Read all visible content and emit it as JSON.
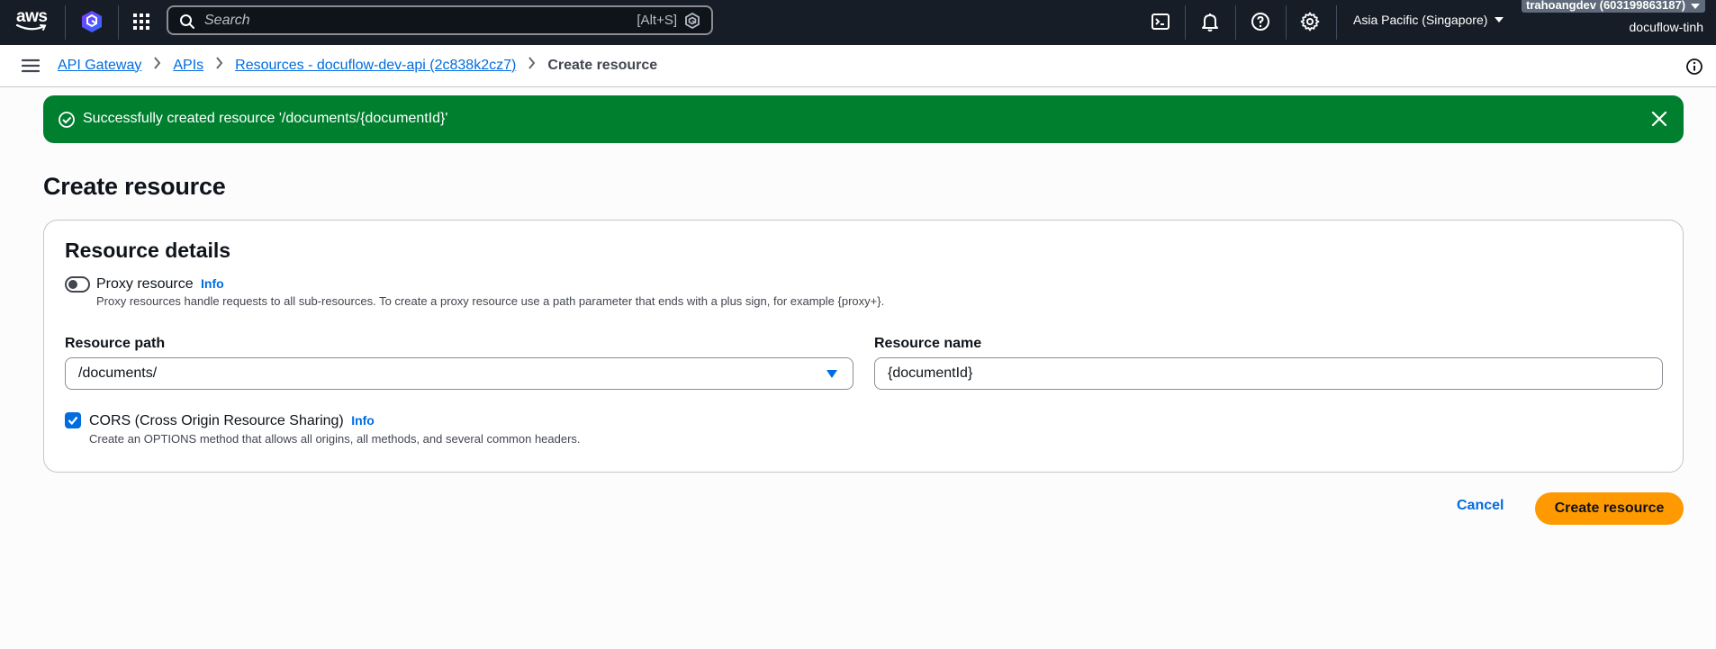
{
  "topnav": {
    "logo_text": "aws",
    "search_placeholder": "Search",
    "search_shortcut": "[Alt+S]",
    "region": "Asia Pacific (Singapore)",
    "account_tag": "trahoangdev (603199863187)",
    "account_user": "docuflow-tinh",
    "icons": [
      "cloudshell-icon",
      "bell-icon",
      "help-icon",
      "settings-icon"
    ]
  },
  "breadcrumb": {
    "items": [
      "API Gateway",
      "APIs",
      "Resources - docuflow-dev-api (2c838k2cz7)"
    ],
    "current": "Create resource"
  },
  "flash": {
    "message": "Successfully created resource '/documents/{documentId}'",
    "color": "#00802f"
  },
  "page": {
    "title": "Create resource"
  },
  "card": {
    "title": "Resource details",
    "proxy": {
      "label": "Proxy resource",
      "info": "Info",
      "description": "Proxy resources handle requests to all sub-resources. To create a proxy resource use a path parameter that ends with a plus sign, for example {proxy+}.",
      "enabled": false
    },
    "resource_path": {
      "label": "Resource path",
      "value": "/documents/"
    },
    "resource_name": {
      "label": "Resource name",
      "value": "{documentId}"
    },
    "cors": {
      "label": "CORS (Cross Origin Resource Sharing)",
      "info": "Info",
      "description": "Create an OPTIONS method that allows all origins, all methods, and several common headers.",
      "checked": true
    }
  },
  "actions": {
    "cancel": "Cancel",
    "submit": "Create resource",
    "submit_color": "#ff9900"
  }
}
